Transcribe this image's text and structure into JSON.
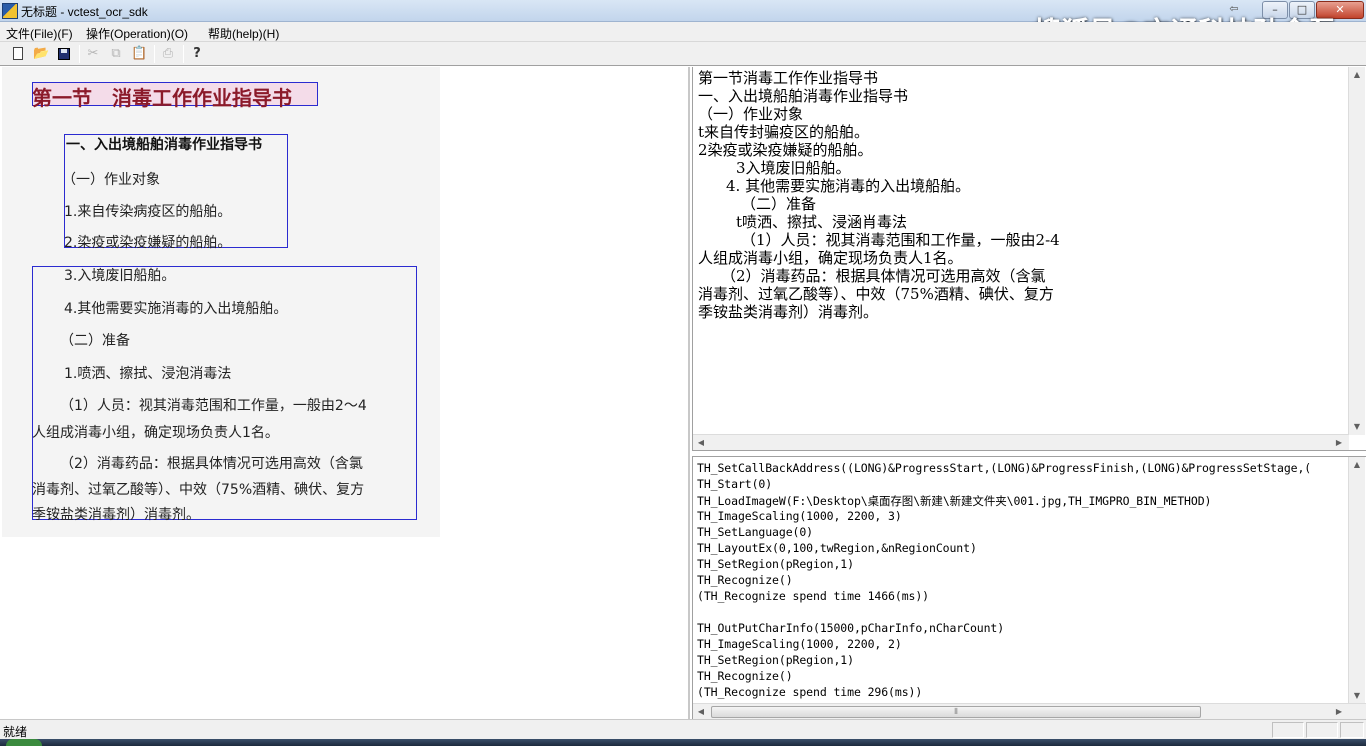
{
  "window": {
    "title": "无标题 - vctest_ocr_sdk",
    "watermark": "搜狐号@文通科技孙金磊",
    "minimize_glyph": "–",
    "maximize_glyph": "□",
    "close_glyph": "✕",
    "back_glyph": "⇦"
  },
  "menu": {
    "file": "文件(File)(F)",
    "operation": "操作(Operation)(O)",
    "help": "帮助(help)(H)"
  },
  "toolbar": {
    "icons": [
      "new-document-icon",
      "open-folder-icon",
      "save-icon",
      "cut-icon",
      "copy-icon",
      "paste-icon",
      "print-icon",
      "help-icon"
    ],
    "open_glyph": "📂",
    "cut_glyph": "✂",
    "copy_glyph": "⧉",
    "paste_glyph": "📋",
    "print_glyph": "⎙",
    "help_glyph": "?"
  },
  "document": {
    "title": "第一节　消毒工作作业指导书",
    "heading": "一、入出境船舶消毒作业指导书",
    "line1": "（一）作业对象",
    "line2": "1.来自传染病疫区的船舶。",
    "line3": "2.染疫或染疫嫌疑的船舶。",
    "line4": "3.入境废旧船舶。",
    "line5": "4.其他需要实施消毒的入出境船舶。",
    "line6": "（二）准备",
    "line7": "1.喷洒、擦拭、浸泡消毒法",
    "line8": "（1）人员：视其消毒范围和工作量，一般由2～4",
    "line9": "人组成消毒小组，确定现场负责人1名。",
    "line10": "（2）消毒药品：根据具体情况可选用高效（含氯",
    "line11": "消毒剂、过氧乙酸等）、中效（75%酒精、碘伏、复方",
    "line12": "季铵盐类消毒剂）消毒剂。"
  },
  "ocr_result": {
    "l1": "第一节消毒工作作业指导书",
    "l2": "一、入出境船舶消毒作业指导书",
    "l3": "（一）作业对象",
    "l4": "t来自传封骗疫区的船舶。",
    "l5": "2染疫或染疫嫌疑的船舶。",
    "l6": "3入境废旧船舶。",
    "l7": "4. 其他需要实施消毒的入出境船舶。",
    "l8": "（二）准备",
    "l9": "t喷洒、擦拭、浸涵肖毒法",
    "l10": "（1）人员：视其消毒范围和工作量，一般由2-4",
    "l11": "人组成消毒小组，确定现场负责人1名。",
    "l12": "（2）消毒药品：根据具体情况可选用高效（含氯",
    "l13": "消毒剂、过氧乙酸等）、中效（75%酒精、碘伏、复方",
    "l14": "季铵盐类消毒剂）消毒剂。"
  },
  "log": {
    "l1": "TH_SetCallBackAddress((LONG)&ProgressStart,(LONG)&ProgressFinish,(LONG)&ProgressSetStage,(",
    "l2": "TH_Start(0)",
    "l3": "TH_LoadImageW(F:\\Desktop\\桌面存图\\新建\\新建文件夹\\001.jpg,TH_IMGPRO_BIN_METHOD)",
    "l4": "TH_ImageScaling(1000, 2200, 3)",
    "l5": "TH_SetLanguage(0)",
    "l6": "TH_LayoutEx(0,100,twRegion,&nRegionCount)",
    "l7": "TH_SetRegion(pRegion,1)",
    "l8": "TH_Recognize()",
    "l9": "(TH_Recognize spend time 1466(ms))",
    "l10": "TH_OutPutCharInfo(15000,pCharInfo,nCharCount)",
    "l11": "TH_ImageScaling(1000, 2200, 2)",
    "l12": "TH_SetRegion(pRegion,1)",
    "l13": "TH_Recognize()",
    "l14": "(TH_Recognize spend time 296(ms))"
  },
  "scroll": {
    "up": "▲",
    "down": "▼",
    "left": "◀",
    "right": "▶",
    "grip": "⦀"
  },
  "status": {
    "text": "就绪"
  }
}
